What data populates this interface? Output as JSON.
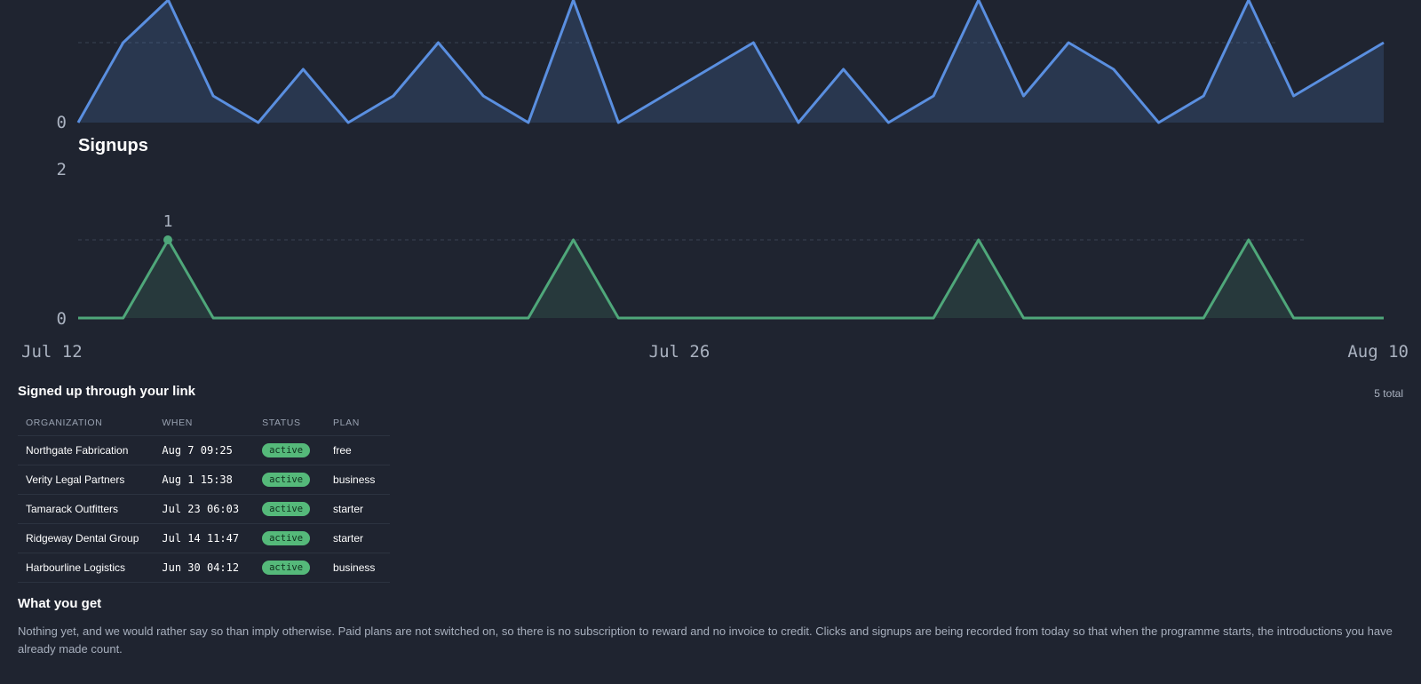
{
  "charts": {
    "clicks": {
      "zero_label": "0",
      "color": "#5a8fe0"
    },
    "signups": {
      "title": "Signups",
      "max_label": "2",
      "zero_label": "0",
      "peak_label": "1",
      "color": "#4fa77a"
    },
    "x_ticks": [
      "Jul 12",
      "Jul 26",
      "Aug 10"
    ]
  },
  "chart_data": [
    {
      "type": "area",
      "title": "",
      "x": [
        "Jul 12",
        "Jul 13",
        "Jul 14",
        "Jul 15",
        "Jul 16",
        "Jul 17",
        "Jul 18",
        "Jul 19",
        "Jul 20",
        "Jul 21",
        "Jul 22",
        "Jul 23",
        "Jul 24",
        "Jul 25",
        "Jul 26",
        "Jul 27",
        "Jul 28",
        "Jul 29",
        "Jul 30",
        "Jul 31",
        "Aug 1",
        "Aug 2",
        "Aug 3",
        "Aug 4",
        "Aug 5",
        "Aug 6",
        "Aug 7",
        "Aug 8",
        "Aug 9",
        "Aug 10"
      ],
      "values": [
        0,
        1.5,
        2.3,
        0.5,
        0,
        1,
        0,
        0.5,
        1.5,
        0.5,
        0,
        2.3,
        0,
        0.5,
        1,
        1.5,
        0,
        1,
        0,
        0.5,
        2.3,
        0.5,
        1.5,
        1,
        0,
        0.5,
        2.3,
        0.5,
        1,
        1.5
      ],
      "ylim": [
        0,
        2.3
      ],
      "grid": true
    },
    {
      "type": "area",
      "title": "Signups",
      "x": [
        "Jul 12",
        "Jul 13",
        "Jul 14",
        "Jul 15",
        "Jul 16",
        "Jul 17",
        "Jul 18",
        "Jul 19",
        "Jul 20",
        "Jul 21",
        "Jul 22",
        "Jul 23",
        "Jul 24",
        "Jul 25",
        "Jul 26",
        "Jul 27",
        "Jul 28",
        "Jul 29",
        "Jul 30",
        "Jul 31",
        "Aug 1",
        "Aug 2",
        "Aug 3",
        "Aug 4",
        "Aug 5",
        "Aug 6",
        "Aug 7",
        "Aug 8",
        "Aug 9",
        "Aug 10"
      ],
      "values": [
        0,
        0,
        1,
        0,
        0,
        0,
        0,
        0,
        0,
        0,
        0,
        1,
        0,
        0,
        0,
        0,
        0,
        0,
        0,
        0,
        1,
        0,
        0,
        0,
        0,
        0,
        1,
        0,
        0,
        0
      ],
      "ylim": [
        0,
        2
      ],
      "grid": true
    }
  ],
  "signups_section": {
    "title": "Signed up through your link",
    "total": "5 total",
    "columns": [
      "ORGANIZATION",
      "WHEN",
      "STATUS",
      "PLAN"
    ],
    "rows": [
      {
        "org": "Northgate Fabrication",
        "when": "Aug 7 09:25",
        "status": "active",
        "plan": "free"
      },
      {
        "org": "Verity Legal Partners",
        "when": "Aug 1 15:38",
        "status": "active",
        "plan": "business"
      },
      {
        "org": "Tamarack Outfitters",
        "when": "Jul 23 06:03",
        "status": "active",
        "plan": "starter"
      },
      {
        "org": "Ridgeway Dental Group",
        "when": "Jul 14 11:47",
        "status": "active",
        "plan": "starter"
      },
      {
        "org": "Harbourline Logistics",
        "when": "Jun 30 04:12",
        "status": "active",
        "plan": "business"
      }
    ]
  },
  "benefits": {
    "title": "What you get",
    "text": "Nothing yet, and we would rather say so than imply otherwise. Paid plans are not switched on, so there is no subscription to reward and no invoice to credit. Clicks and signups are being recorded from today so that when the programme starts, the introductions you have already made count."
  }
}
